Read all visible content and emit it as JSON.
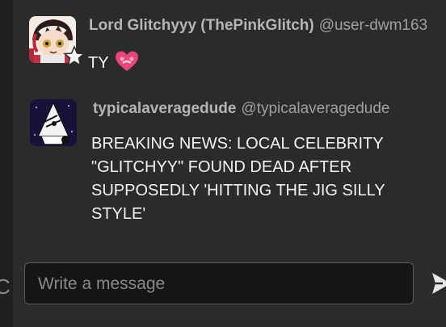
{
  "messages": [
    {
      "author_name": "Lord Glitchyyy (ThePinkGlitch)",
      "author_handle": "@user-dwm163",
      "text": "TY",
      "emoji": "heart-with-ribbon",
      "avatar": "anime-character-avatar",
      "badge": "star-icon"
    },
    {
      "author_name": "typicalaveragedude",
      "author_handle": "@typicalaveragedude",
      "text": "BREAKING NEWS: LOCAL CELEBRITY \"GLITCHYY\" FOUND DEAD AFTER SUPPOSEDLY 'HITTING THE JIG SILLY STYLE'",
      "avatar": "sketch-character-avatar"
    }
  ],
  "composer": {
    "placeholder": "Write a message",
    "value": ""
  },
  "icons": {
    "send": "send-icon",
    "left_edge": "C"
  },
  "colors": {
    "background": "#2b2b2b",
    "text": "#f2f2f2",
    "author": "#b5b5b5",
    "emoji_pink": "#e8457a"
  }
}
